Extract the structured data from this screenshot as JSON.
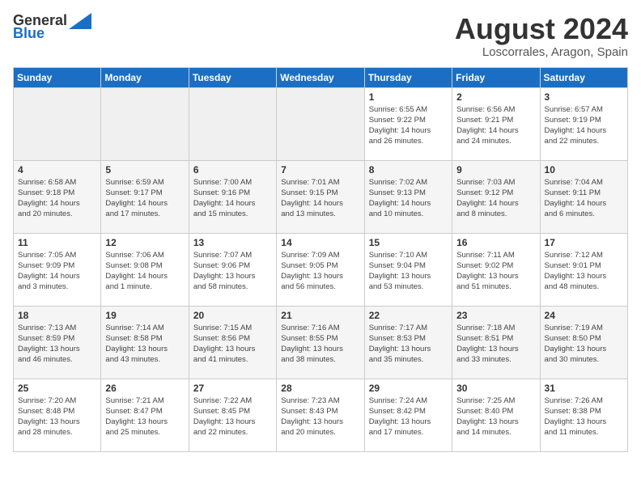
{
  "header": {
    "logo_line1": "General",
    "logo_line2": "Blue",
    "title": "August 2024",
    "subtitle": "Loscorrales, Aragon, Spain"
  },
  "weekdays": [
    "Sunday",
    "Monday",
    "Tuesday",
    "Wednesday",
    "Thursday",
    "Friday",
    "Saturday"
  ],
  "weeks": [
    [
      {
        "day": "",
        "empty": true
      },
      {
        "day": "",
        "empty": true
      },
      {
        "day": "",
        "empty": true
      },
      {
        "day": "",
        "empty": true
      },
      {
        "day": "1",
        "info": "Sunrise: 6:55 AM\nSunset: 9:22 PM\nDaylight: 14 hours\nand 26 minutes."
      },
      {
        "day": "2",
        "info": "Sunrise: 6:56 AM\nSunset: 9:21 PM\nDaylight: 14 hours\nand 24 minutes."
      },
      {
        "day": "3",
        "info": "Sunrise: 6:57 AM\nSunset: 9:19 PM\nDaylight: 14 hours\nand 22 minutes."
      }
    ],
    [
      {
        "day": "4",
        "info": "Sunrise: 6:58 AM\nSunset: 9:18 PM\nDaylight: 14 hours\nand 20 minutes."
      },
      {
        "day": "5",
        "info": "Sunrise: 6:59 AM\nSunset: 9:17 PM\nDaylight: 14 hours\nand 17 minutes."
      },
      {
        "day": "6",
        "info": "Sunrise: 7:00 AM\nSunset: 9:16 PM\nDaylight: 14 hours\nand 15 minutes."
      },
      {
        "day": "7",
        "info": "Sunrise: 7:01 AM\nSunset: 9:15 PM\nDaylight: 14 hours\nand 13 minutes."
      },
      {
        "day": "8",
        "info": "Sunrise: 7:02 AM\nSunset: 9:13 PM\nDaylight: 14 hours\nand 10 minutes."
      },
      {
        "day": "9",
        "info": "Sunrise: 7:03 AM\nSunset: 9:12 PM\nDaylight: 14 hours\nand 8 minutes."
      },
      {
        "day": "10",
        "info": "Sunrise: 7:04 AM\nSunset: 9:11 PM\nDaylight: 14 hours\nand 6 minutes."
      }
    ],
    [
      {
        "day": "11",
        "info": "Sunrise: 7:05 AM\nSunset: 9:09 PM\nDaylight: 14 hours\nand 3 minutes."
      },
      {
        "day": "12",
        "info": "Sunrise: 7:06 AM\nSunset: 9:08 PM\nDaylight: 14 hours\nand 1 minute."
      },
      {
        "day": "13",
        "info": "Sunrise: 7:07 AM\nSunset: 9:06 PM\nDaylight: 13 hours\nand 58 minutes."
      },
      {
        "day": "14",
        "info": "Sunrise: 7:09 AM\nSunset: 9:05 PM\nDaylight: 13 hours\nand 56 minutes."
      },
      {
        "day": "15",
        "info": "Sunrise: 7:10 AM\nSunset: 9:04 PM\nDaylight: 13 hours\nand 53 minutes."
      },
      {
        "day": "16",
        "info": "Sunrise: 7:11 AM\nSunset: 9:02 PM\nDaylight: 13 hours\nand 51 minutes."
      },
      {
        "day": "17",
        "info": "Sunrise: 7:12 AM\nSunset: 9:01 PM\nDaylight: 13 hours\nand 48 minutes."
      }
    ],
    [
      {
        "day": "18",
        "info": "Sunrise: 7:13 AM\nSunset: 8:59 PM\nDaylight: 13 hours\nand 46 minutes."
      },
      {
        "day": "19",
        "info": "Sunrise: 7:14 AM\nSunset: 8:58 PM\nDaylight: 13 hours\nand 43 minutes."
      },
      {
        "day": "20",
        "info": "Sunrise: 7:15 AM\nSunset: 8:56 PM\nDaylight: 13 hours\nand 41 minutes."
      },
      {
        "day": "21",
        "info": "Sunrise: 7:16 AM\nSunset: 8:55 PM\nDaylight: 13 hours\nand 38 minutes."
      },
      {
        "day": "22",
        "info": "Sunrise: 7:17 AM\nSunset: 8:53 PM\nDaylight: 13 hours\nand 35 minutes."
      },
      {
        "day": "23",
        "info": "Sunrise: 7:18 AM\nSunset: 8:51 PM\nDaylight: 13 hours\nand 33 minutes."
      },
      {
        "day": "24",
        "info": "Sunrise: 7:19 AM\nSunset: 8:50 PM\nDaylight: 13 hours\nand 30 minutes."
      }
    ],
    [
      {
        "day": "25",
        "info": "Sunrise: 7:20 AM\nSunset: 8:48 PM\nDaylight: 13 hours\nand 28 minutes."
      },
      {
        "day": "26",
        "info": "Sunrise: 7:21 AM\nSunset: 8:47 PM\nDaylight: 13 hours\nand 25 minutes."
      },
      {
        "day": "27",
        "info": "Sunrise: 7:22 AM\nSunset: 8:45 PM\nDaylight: 13 hours\nand 22 minutes."
      },
      {
        "day": "28",
        "info": "Sunrise: 7:23 AM\nSunset: 8:43 PM\nDaylight: 13 hours\nand 20 minutes."
      },
      {
        "day": "29",
        "info": "Sunrise: 7:24 AM\nSunset: 8:42 PM\nDaylight: 13 hours\nand 17 minutes."
      },
      {
        "day": "30",
        "info": "Sunrise: 7:25 AM\nSunset: 8:40 PM\nDaylight: 13 hours\nand 14 minutes."
      },
      {
        "day": "31",
        "info": "Sunrise: 7:26 AM\nSunset: 8:38 PM\nDaylight: 13 hours\nand 11 minutes."
      }
    ]
  ]
}
